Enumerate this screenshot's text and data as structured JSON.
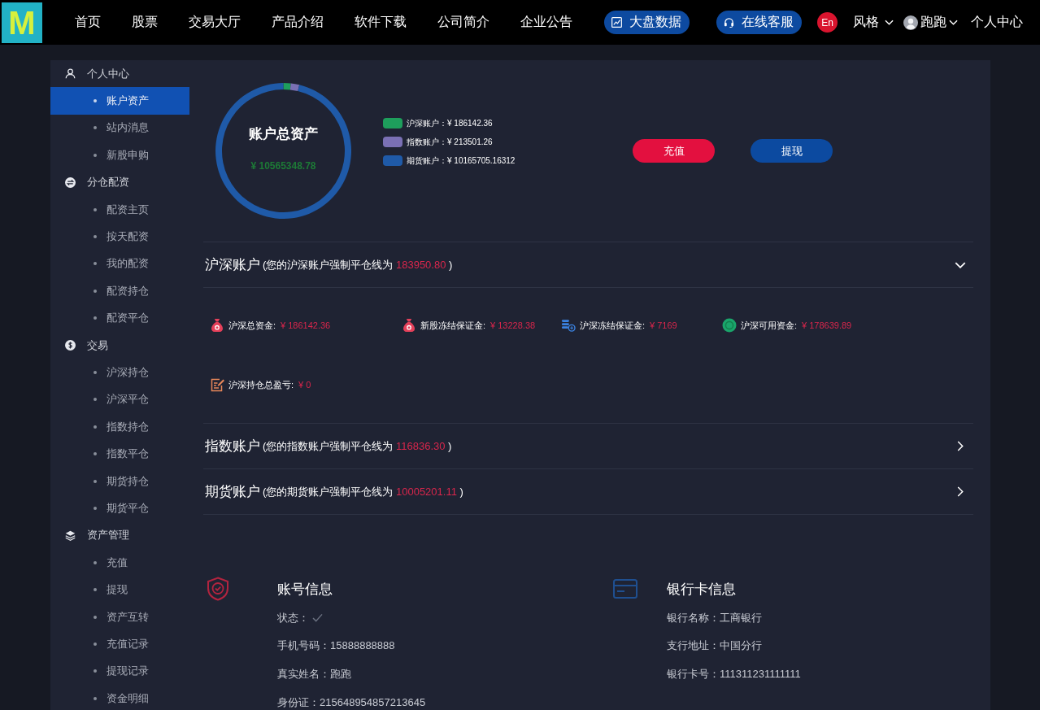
{
  "nav": {
    "logo": "M",
    "links": [
      "首页",
      "股票",
      "交易大厅",
      "产品介绍",
      "软件下载",
      "公司简介",
      "企业公告"
    ],
    "pills": [
      "大盘数据",
      "在线客服"
    ],
    "language": "En",
    "style_menu": "风格",
    "user_menu": "跑跑",
    "account_link": "个人中心"
  },
  "sidebar": {
    "groups": [
      {
        "label": "个人中心",
        "items": [
          {
            "label": "账户资产",
            "selected": true
          },
          {
            "label": "站内消息",
            "selected": false
          },
          {
            "label": "新股申购",
            "selected": false
          }
        ]
      },
      {
        "label": "分仓配资",
        "items": [
          {
            "label": "配资主页",
            "selected": false
          },
          {
            "label": "按天配资",
            "selected": false
          },
          {
            "label": "我的配资",
            "selected": false
          },
          {
            "label": "配资持仓",
            "selected": false
          },
          {
            "label": "配资平仓",
            "selected": false
          }
        ]
      },
      {
        "label": "交易",
        "items": [
          {
            "label": "沪深持仓",
            "selected": false
          },
          {
            "label": "沪深平仓",
            "selected": false
          },
          {
            "label": "指数持仓",
            "selected": false
          },
          {
            "label": "指数平仓",
            "selected": false
          },
          {
            "label": "期货持仓",
            "selected": false
          },
          {
            "label": "期货平仓",
            "selected": false
          }
        ]
      },
      {
        "label": "资产管理",
        "items": [
          {
            "label": "充值",
            "selected": false
          },
          {
            "label": "提现",
            "selected": false
          },
          {
            "label": "资产互转",
            "selected": false
          },
          {
            "label": "充值记录",
            "selected": false
          },
          {
            "label": "提现记录",
            "selected": false
          },
          {
            "label": "资金明细",
            "selected": false
          }
        ]
      }
    ]
  },
  "assets": {
    "chart_data": {
      "type": "donut",
      "title": "账户总资产",
      "categories": [
        "沪深账户",
        "指数账户",
        "期货账户"
      ],
      "values": [
        1.76,
        2.02,
        96.22
      ]
    },
    "total": "¥ 10565348.78",
    "legend": [
      {
        "amount": "：¥ 186142.36",
        "color": "#1e9e5c"
      },
      {
        "amount": "：¥ 213501.26",
        "color": "#7a70b4"
      },
      {
        "amount": "：¥ 10165705.16312",
        "color": "#1f5aa8"
      }
    ],
    "buttons": [
      {
        "label": "充值",
        "color": "#e3103f"
      },
      {
        "label": "提现",
        "color": "#0c4aa0"
      }
    ]
  },
  "accounts": [
    {
      "title": "沪深账户",
      "note": "(您的沪深账户强制平仓线为",
      "threshold": "183950.80",
      "note_end": ")",
      "expanded": true,
      "stats": [
        {
          "label": "沪深总资金:",
          "value": "¥ 186142.36"
        },
        {
          "label": "新股冻结保证金:",
          "value": "¥ 13228.38"
        },
        {
          "label": "沪深冻结保证金:",
          "value": "¥ 7169"
        },
        {
          "label": "沪深可用资金:",
          "value": "¥ 178639.89"
        },
        {
          "label": "沪深持仓总盈亏:",
          "value": "¥ 0"
        }
      ]
    },
    {
      "title": "指数账户",
      "note": "(您的指数账户强制平仓线为",
      "threshold": "116836.30",
      "note_end": ")",
      "expanded": false
    },
    {
      "title": "期货账户",
      "note": "(您的期货账户强制平仓线为",
      "threshold": "10005201.11",
      "note_end": ")",
      "expanded": false
    }
  ],
  "info": [
    {
      "title": "账号信息",
      "fields": [
        {
          "kind": "status",
          "label": "状态：",
          "checked": true
        },
        {
          "kind": "text",
          "label": "手机号码：",
          "value": "15888888888"
        },
        {
          "kind": "text",
          "label": "真实姓名：",
          "value": "跑跑"
        },
        {
          "kind": "text",
          "label": "身份证：",
          "value": "215648954857213645"
        }
      ]
    },
    {
      "title": "银行卡信息",
      "fields": [
        {
          "kind": "text",
          "label": "银行名称：",
          "value": "工商银行"
        },
        {
          "kind": "text",
          "label": "支行地址：",
          "value": "中国分行"
        },
        {
          "kind": "text",
          "label": "银行卡号：",
          "value": "111311231111111"
        }
      ]
    }
  ]
}
